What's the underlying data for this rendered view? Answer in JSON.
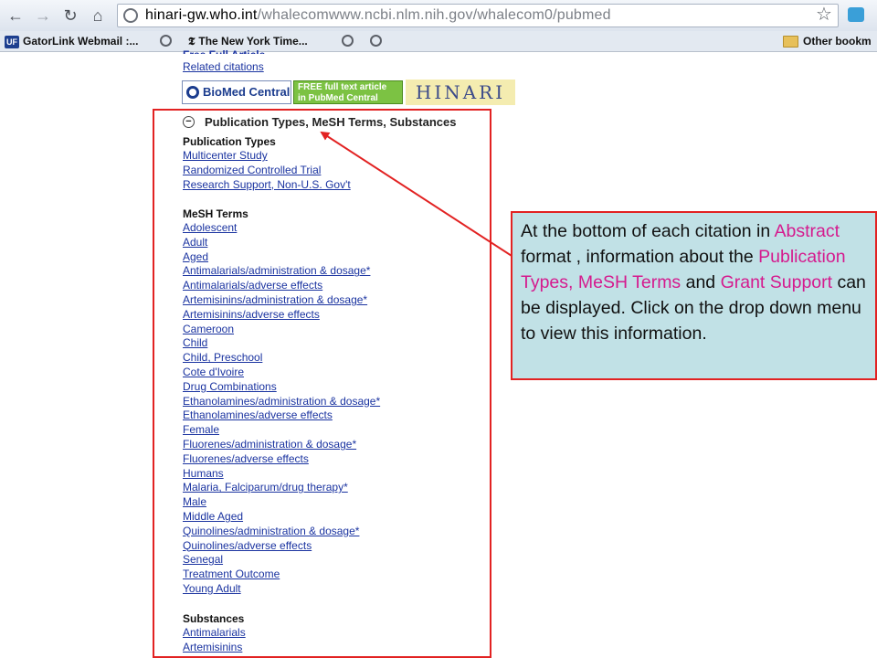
{
  "browser": {
    "url_host": "hinari-gw.who.int",
    "url_path": "/whalecomwww.ncbi.nlm.nih.gov/whalecom0/pubmed",
    "nav_icons": [
      "back-arrow-icon",
      "forward-arrow-icon",
      "reload-icon",
      "home-icon"
    ],
    "bookmarks": [
      {
        "label": "GatorLink Webmail :...",
        "badge": "UF"
      },
      {
        "label": "The New York Time...",
        "badge": "𝕿"
      }
    ],
    "other_bookmarks_label": "Other bookm"
  },
  "page": {
    "top_cut_link": "Free Full Article",
    "related_citations": "Related citations",
    "logos": {
      "bmc": "BioMed Central",
      "pmc_line1": "FREE full text article",
      "pmc_line2": "in PubMed Central",
      "hinari": "HINARI"
    },
    "section_title": "Publication Types, MeSH Terms, Substances",
    "collapse_symbol": "−",
    "publication_types_heading": "Publication Types",
    "publication_types": [
      "Multicenter Study",
      "Randomized Controlled Trial",
      "Research Support, Non-U.S. Gov't"
    ],
    "mesh_heading": "MeSH Terms",
    "mesh_terms": [
      "Adolescent",
      "Adult",
      "Aged",
      "Antimalarials/administration & dosage*",
      "Antimalarials/adverse effects",
      "Artemisinins/administration & dosage*",
      "Artemisinins/adverse effects",
      "Cameroon",
      "Child",
      "Child, Preschool",
      "Cote d'Ivoire",
      "Drug Combinations",
      "Ethanolamines/administration & dosage*",
      "Ethanolamines/adverse effects",
      "Female",
      "Fluorenes/administration & dosage*",
      "Fluorenes/adverse effects",
      "Humans",
      "Malaria, Falciparum/drug therapy*",
      "Male",
      "Middle Aged",
      "Quinolines/administration & dosage*",
      "Quinolines/adverse effects",
      "Senegal",
      "Treatment Outcome",
      "Young Adult"
    ],
    "substances_heading": "Substances",
    "substances": [
      "Antimalarials",
      "Artemisinins"
    ]
  },
  "callout": {
    "t1": "At the bottom of each citation in ",
    "h1": "Abstract",
    "t2": " format , information about the ",
    "h2": "Publication Types, MeSH Terms",
    "t3": " and ",
    "h3": "Grant Support",
    "t4": " can be displayed.  Click on the drop down menu to view this information."
  },
  "colors": {
    "annotation_border": "#e22222",
    "callout_bg": "#c1e1e6",
    "highlight_text": "#d51a8e",
    "link": "#1a33a0"
  }
}
